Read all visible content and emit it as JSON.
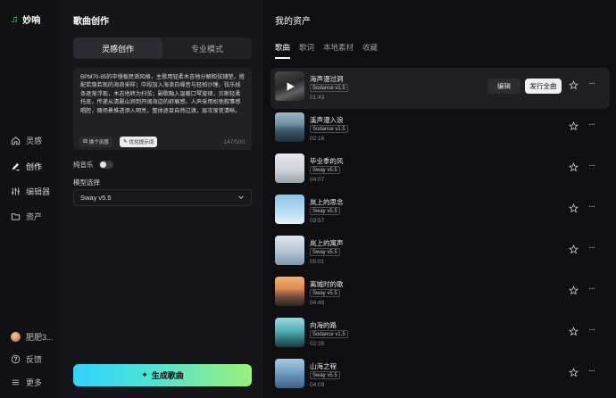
{
  "brand": {
    "name": "妙响"
  },
  "nav": {
    "items": [
      {
        "label": "灵感",
        "icon": "home-icon"
      },
      {
        "label": "创作",
        "icon": "pen-icon",
        "active": true
      },
      {
        "label": "编辑器",
        "icon": "sliders-icon"
      },
      {
        "label": "资产",
        "icon": "folder-icon"
      }
    ],
    "user": {
      "name": "肥肥3..."
    },
    "feedback": "反馈",
    "more": "更多"
  },
  "create": {
    "title": "歌曲创作",
    "tabs": [
      {
        "label": "灵感创作",
        "active": true
      },
      {
        "label": "专业模式",
        "active": false
      }
    ],
    "prompt": "BPM70-85的中慢板民谣风格，主歌用轻柔木吉他分解和弦铺垫，搭配若隐若现的海浪采样；中段加入海浪白噪音与轻拍沙锤，弦乐线条逐渐浮现，木吉他转为扫弦；副歌融入温暖口琴旋律，贝斯轻柔托底，传递从清晨山涧到开阔海边的舒展感。人声采用松弛叙事感唱腔，随场景推进添入明亮，整体逐目自然过渡，层次渐变清晰。",
    "chip_random": "换个灵感",
    "chip_optimize": "优化提示词",
    "counter": "147/500",
    "instrumental_label": "纯音乐",
    "model_label": "模型选择",
    "model_value": "Sway v5.5",
    "generate_label": "生成歌曲"
  },
  "assets": {
    "title": "我的资产",
    "tabs": [
      {
        "label": "歌曲",
        "active": true
      },
      {
        "label": "歌词",
        "active": false
      },
      {
        "label": "本地素材",
        "active": false
      },
      {
        "label": "收藏",
        "active": false
      }
    ],
    "edit_label": "编辑",
    "publish_label": "发行全曲",
    "songs": [
      {
        "title": "海声漫过洞",
        "version": "Sodance v1.5",
        "duration": "01:43",
        "active": true
      },
      {
        "title": "溪声漫入浪",
        "version": "Sodance v1.5",
        "duration": "02:16"
      },
      {
        "title": "毕业季的风",
        "version": "Sway v5.5",
        "duration": "04:07"
      },
      {
        "title": "岚上的思念",
        "version": "Sway v5.5",
        "duration": "03:57"
      },
      {
        "title": "岚上的寓声",
        "version": "Sway v5.5",
        "duration": "05:01"
      },
      {
        "title": "离城时的歌",
        "version": "Sway v5.5",
        "duration": "04:48"
      },
      {
        "title": "向海的路",
        "version": "Sodance v1.5",
        "duration": "02:35"
      },
      {
        "title": "山海之程",
        "version": "Sway v5.5",
        "duration": "04:09"
      }
    ]
  }
}
